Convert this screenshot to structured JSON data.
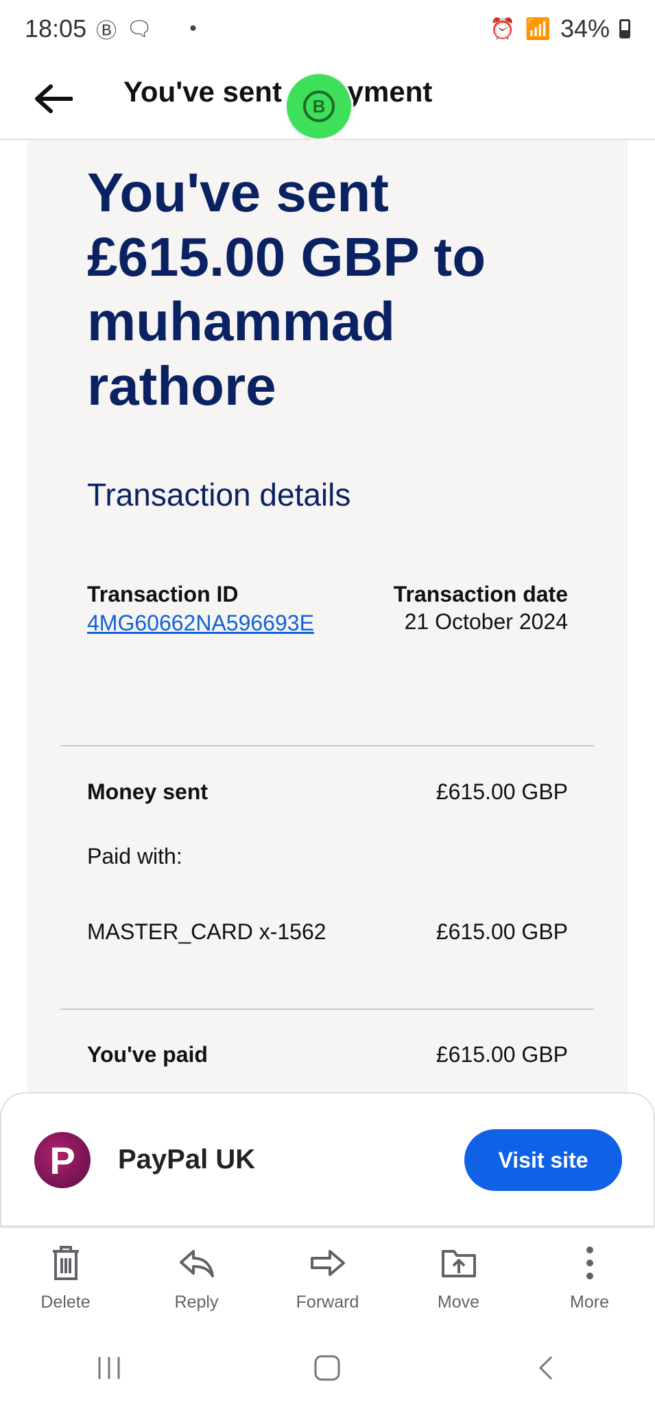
{
  "status_bar": {
    "time": "18:05",
    "battery": "34%"
  },
  "header": {
    "title": "You've sent a payment"
  },
  "receipt": {
    "headline": "You've sent £615.00 GBP to muhammad rathore",
    "section_title": "Transaction details",
    "transaction_id_label": "Transaction ID",
    "transaction_id": "4MG60662NA596693E",
    "transaction_date_label": "Transaction date",
    "transaction_date": "21 October 2024",
    "money_sent_label": "Money sent",
    "money_sent_amount": "£615.00 GBP",
    "paid_with_label": "Paid with:",
    "card_label": "MASTER_CARD x-1562",
    "card_amount": "£615.00 GBP",
    "paid_label": "You've paid",
    "paid_amount": "£615.00 GBP"
  },
  "sender_sheet": {
    "name": "PayPal UK",
    "logo_letter": "P",
    "visit_label": "Visit site"
  },
  "toolbar": {
    "delete": "Delete",
    "reply": "Reply",
    "forward": "Forward",
    "move": "Move",
    "more": "More"
  },
  "colors": {
    "headline": "#0b2262",
    "link": "#0f62d9",
    "button": "#0f62e6",
    "card_bg": "#f6f5f3"
  }
}
